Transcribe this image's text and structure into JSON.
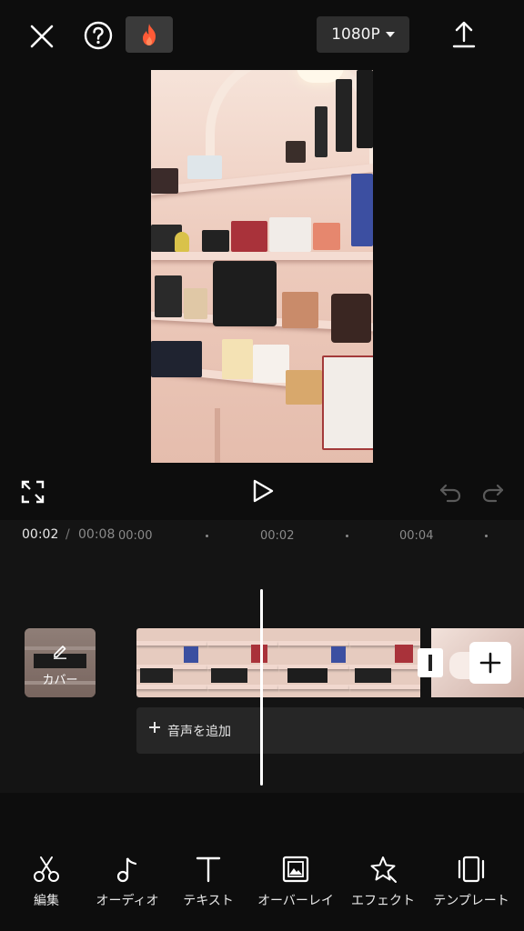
{
  "header": {
    "resolution_label": "1080P",
    "close_icon": "close-icon",
    "help_icon": "help-icon",
    "hot_icon": "flame-icon",
    "export_icon": "upload-icon"
  },
  "playback": {
    "current_time": "00:02",
    "separator": "/",
    "total_time": "00:08"
  },
  "timeline": {
    "tick_labels": [
      "00:00",
      "00:02",
      "00:04"
    ],
    "cover_label": "カバー",
    "add_audio_label": "音声を追加"
  },
  "toolbar": {
    "items": [
      {
        "label": "編集",
        "icon": "scissors-icon"
      },
      {
        "label": "オーディオ",
        "icon": "music-note-icon"
      },
      {
        "label": "テキスト",
        "icon": "text-icon"
      },
      {
        "label": "オーバーレイ",
        "icon": "overlay-icon"
      },
      {
        "label": "エフェクト",
        "icon": "effect-star-icon"
      },
      {
        "label": "テンプレート",
        "icon": "template-icon"
      }
    ]
  },
  "colors": {
    "background": "#0d0d0d",
    "timeline_bg": "#141414",
    "hot_accent": "#ff5a36"
  }
}
